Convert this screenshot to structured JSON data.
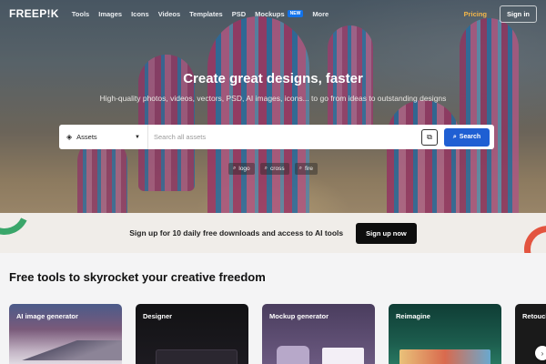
{
  "nav": {
    "logo": "FREEP!K",
    "links": [
      "Tools",
      "Images",
      "Icons",
      "Videos",
      "Templates",
      "PSD",
      "Mockups",
      "More"
    ],
    "new_badge": "NEW",
    "pricing": "Pricing",
    "sign_in": "Sign in"
  },
  "hero": {
    "title": "Create great designs, faster",
    "subtitle": "High-quality photos, videos, vectors, PSD, AI images, icons... to go from ideas to outstanding designs"
  },
  "search": {
    "asset_type": "Assets",
    "placeholder": "Search all assets",
    "button": "Search",
    "suggestions": [
      "logo",
      "cross",
      "fire"
    ]
  },
  "promo": {
    "text": "Sign up for 10 daily free downloads and access to AI tools",
    "button": "Sign up now"
  },
  "tools": {
    "title": "Free tools to skyrocket your creative freedom",
    "cards": [
      "AI image generator",
      "Designer",
      "Mockup generator",
      "Reimagine",
      "Retouch"
    ]
  },
  "colors": {
    "accent_blue": "#1f5fd3",
    "pricing_orange": "#f5b74a",
    "new_badge_blue": "#1273eb"
  },
  "icons": {
    "asset": "diamond-icon",
    "chevron": "chevron-down-icon",
    "image_search": "image-search-icon",
    "search": "search-icon",
    "next": "chevron-right-icon"
  }
}
